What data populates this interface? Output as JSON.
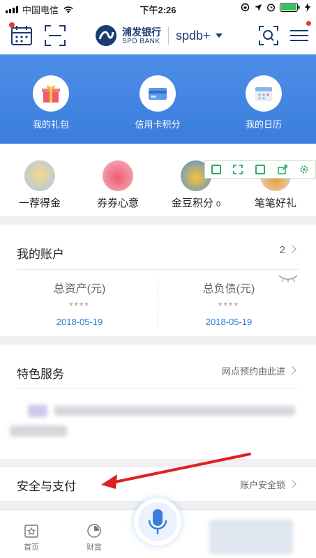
{
  "status_bar": {
    "carrier": "中国电信",
    "time": "下午2:26"
  },
  "header": {
    "bank_name_cn": "浦发银行",
    "bank_name_en": "SPD BANK",
    "app_brand": "spdb+",
    "icons": [
      "calendar-icon",
      "scan-icon",
      "search-icon",
      "menu-icon"
    ]
  },
  "banner": {
    "items": [
      {
        "label": "我的礼包",
        "icon": "gift-icon"
      },
      {
        "label": "信用卡积分",
        "icon": "credit-card-icon"
      },
      {
        "label": "我的日历",
        "icon": "calendar-icon"
      }
    ]
  },
  "promos": {
    "items": [
      {
        "label": "一荐得金",
        "color": "#e8c26a"
      },
      {
        "label": "券券心意",
        "color": "#ef6a7c"
      },
      {
        "label": "金豆积分",
        "badge": "0",
        "color": "#f3b329"
      },
      {
        "label": "笔笔好礼",
        "color": "#f39a33"
      }
    ]
  },
  "account": {
    "title": "我的账户",
    "count": "2",
    "assets_label": "总资产(元)",
    "assets_value": "****",
    "assets_date": "2018-05-19",
    "liabilities_label": "总负债(元)",
    "liabilities_value": "****",
    "liabilities_date": "2018-05-19"
  },
  "special": {
    "title": "特色服务",
    "link": "网点预约由此进"
  },
  "security": {
    "title": "安全与支付",
    "link": "账户安全锁"
  },
  "tabbar": {
    "home": "首页",
    "wealth": "财富"
  },
  "colors": {
    "banner_blue": "#3b7ddd",
    "link_blue": "#2b7bd6",
    "arrow_red": "#e02020"
  }
}
